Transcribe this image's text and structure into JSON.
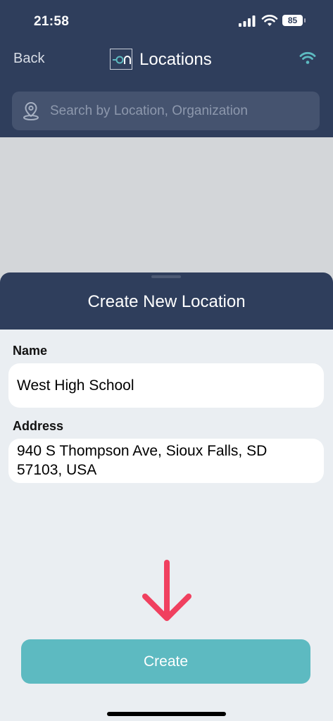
{
  "status_bar": {
    "time": "21:58",
    "battery": "85",
    "icons": [
      "signal-icon",
      "wifi-icon",
      "battery-icon"
    ]
  },
  "nav": {
    "back_label": "Back",
    "logo_text": "on",
    "title": "Locations",
    "wifi_icon": "wifi-icon"
  },
  "search": {
    "placeholder": "Search by Location, Organization",
    "value": "",
    "icon": "location-pin-icon"
  },
  "sheet": {
    "title": "Create New Location",
    "fields": [
      {
        "label": "Name",
        "value": "West High School"
      },
      {
        "label": "Address",
        "value": "940 S Thompson Ave, Sioux Falls, SD 57103, USA"
      }
    ],
    "annotation_icon": "arrow-down-icon",
    "create_label": "Create"
  },
  "colors": {
    "header": "#2f3e5c",
    "search_bg": "#45536f",
    "accent": "#5dbac1",
    "sheet_bg": "#eaeef2",
    "map_bg": "#d3d6d9",
    "annotation": "#f0405f"
  }
}
